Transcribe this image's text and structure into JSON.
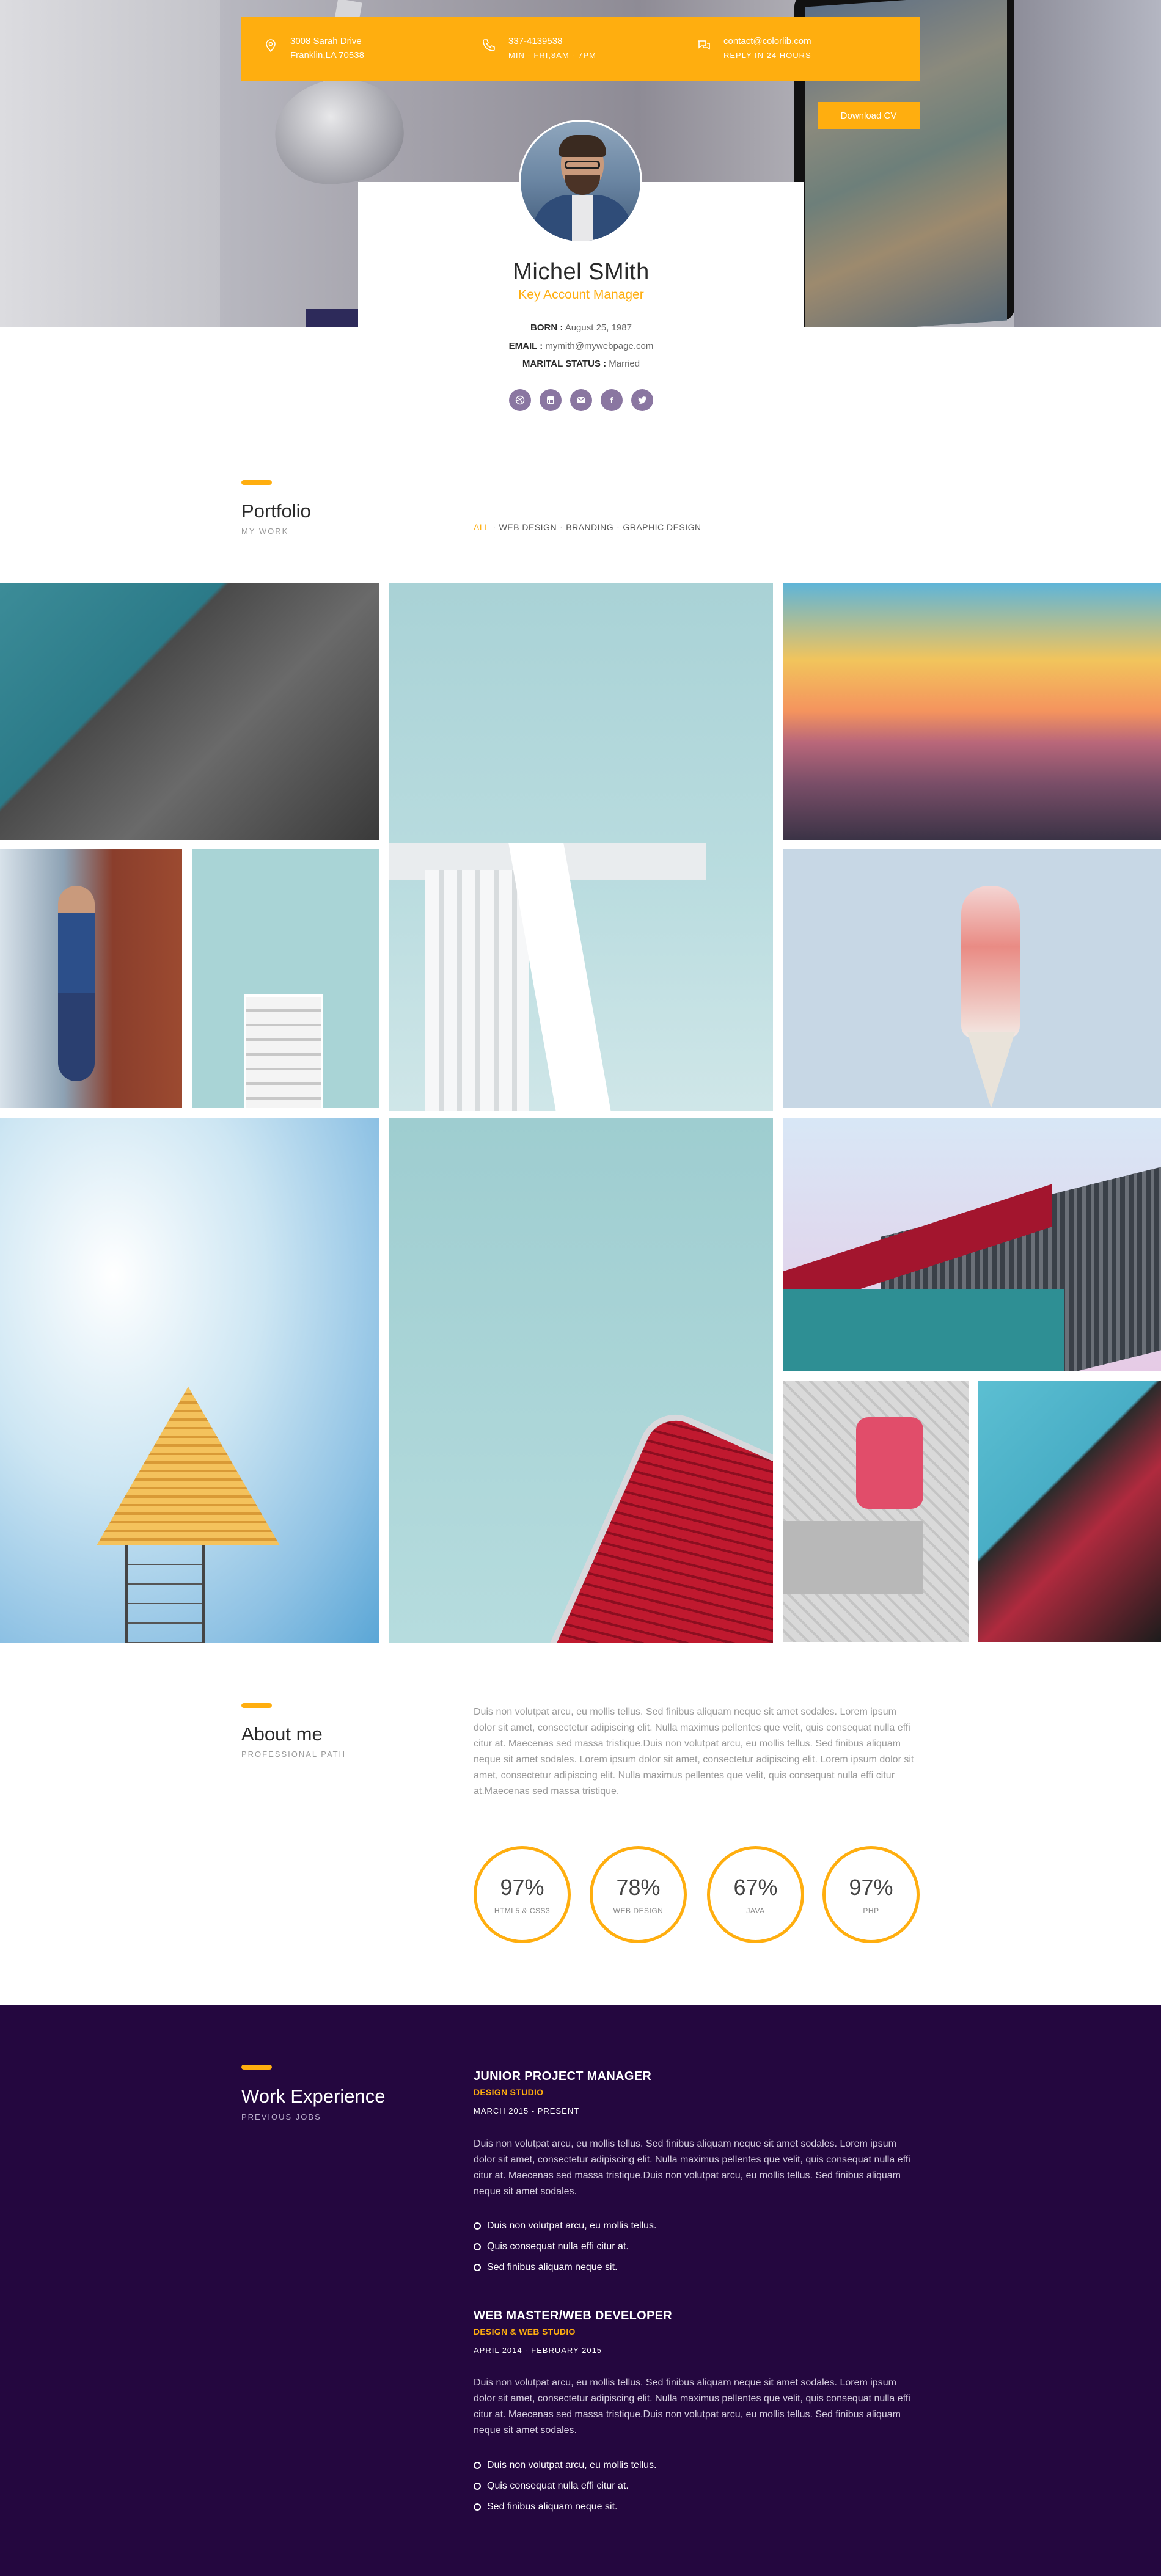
{
  "contact": {
    "address_line1": "3008 Sarah Drive",
    "address_line2": "Franklin,LA 70538",
    "phone_line1": "337-4139538",
    "phone_line2": "MIN - FRI,8AM - 7PM",
    "email_line1": "contact@colorlib.com",
    "email_line2": "REPLY IN 24 HOURS"
  },
  "download_label": "Download CV",
  "profile": {
    "name": "Michel SMith",
    "role": "Key Account Manager",
    "born_label": "BORN :",
    "born_value": " August 25, 1987",
    "email_label": "EMAIL :",
    "email_value": " mymith@mywebpage.com",
    "marital_label": "MARITAL STATUS :",
    "marital_value": " Married"
  },
  "socials": [
    "dribbble-icon",
    "linkedin-icon",
    "email-icon",
    "facebook-icon",
    "twitter-icon"
  ],
  "portfolio": {
    "title": "Portfolio",
    "subtitle": "MY WORK",
    "filters": [
      "ALL",
      "WEB DESIGN",
      "BRANDING",
      "GRAPHIC DESIGN"
    ]
  },
  "about": {
    "title": "About me",
    "subtitle": "PROFESSIONAL PATH",
    "text": "Duis non volutpat arcu, eu mollis tellus. Sed finibus aliquam neque sit amet sodales. Lorem ipsum dolor sit amet, consectetur adipiscing elit. Nulla maximus pellentes que velit, quis consequat nulla effi citur at. Maecenas sed massa tristique.Duis non volutpat arcu, eu mollis tellus. Sed finibus aliquam neque sit amet sodales. Lorem ipsum dolor sit amet, consectetur adipiscing elit. Lorem ipsum dolor sit amet, consectetur adipiscing elit. Nulla maximus pellentes que velit, quis consequat nulla effi citur at.Maecenas sed massa tristique.",
    "skills": [
      {
        "pct": "97%",
        "label": "HTML5 & CSS3",
        "value": 0.97
      },
      {
        "pct": "78%",
        "label": "WEB DESIGN",
        "value": 0.78
      },
      {
        "pct": "67%",
        "label": "JAVA",
        "value": 0.67
      },
      {
        "pct": "97%",
        "label": "PHP",
        "value": 0.97
      }
    ]
  },
  "work": {
    "title": "Work Experience",
    "subtitle": "PREVIOUS JOBS",
    "jobs": [
      {
        "title": "JUNIOR PROJECT MANAGER",
        "company": "DESIGN STUDIO",
        "dates": "MARCH 2015 - PRESENT",
        "desc": "Duis non volutpat arcu, eu mollis tellus. Sed finibus aliquam neque sit amet sodales. Lorem ipsum dolor sit amet, consectetur adipiscing elit. Nulla maximus pellentes que velit, quis consequat nulla effi citur at. Maecenas sed massa tristique.Duis non volutpat arcu, eu mollis tellus. Sed finibus aliquam neque sit amet sodales.",
        "bullets": [
          "Duis non volutpat arcu, eu mollis tellus.",
          "Quis consequat nulla effi citur at.",
          "Sed finibus aliquam neque sit."
        ]
      },
      {
        "title": "WEB MASTER/WEB DEVELOPER",
        "company": "DESIGN & WEB STUDIO",
        "dates": "APRIL 2014 - FEBRUARY 2015",
        "desc": "Duis non volutpat arcu, eu mollis tellus. Sed finibus aliquam neque sit amet sodales. Lorem ipsum dolor sit amet, consectetur adipiscing elit. Nulla maximus pellentes que velit, quis consequat nulla effi citur at. Maecenas sed massa tristique.Duis non volutpat arcu, eu mollis tellus. Sed finibus aliquam neque sit amet sodales.",
        "bullets": [
          "Duis non volutpat arcu, eu mollis tellus.",
          "Quis consequat nulla effi citur at.",
          "Sed finibus aliquam neque sit."
        ]
      }
    ]
  },
  "colors": {
    "accent": "#ffae0f",
    "work_bg": "#24073f",
    "social": "#8a76a1"
  }
}
